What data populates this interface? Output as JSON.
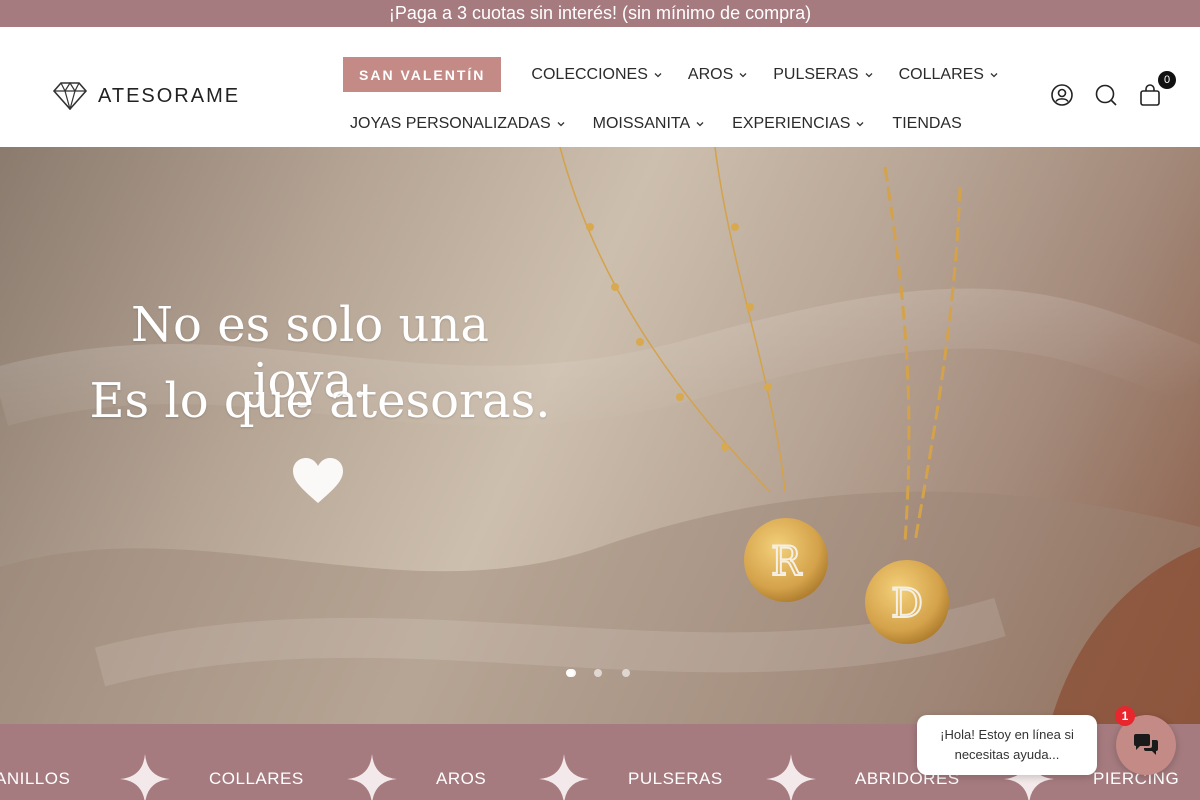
{
  "announcement": {
    "text": "¡Paga a 3 cuotas sin interés! (sin mínimo de compra)"
  },
  "header": {
    "logo_text": "ATESORAME",
    "nav_row1": [
      {
        "label": "SAN VALENTÍN",
        "highlight": true
      },
      {
        "label": "COLECCIONES",
        "dropdown": true
      },
      {
        "label": "AROS",
        "dropdown": true
      },
      {
        "label": "PULSERAS",
        "dropdown": true
      },
      {
        "label": "COLLARES",
        "dropdown": true
      }
    ],
    "nav_row2": [
      {
        "label": "JOYAS PERSONALIZADAS",
        "dropdown": true
      },
      {
        "label": "MOISSANITA",
        "dropdown": true
      },
      {
        "label": "EXPERIENCIAS",
        "dropdown": true
      },
      {
        "label": "TIENDAS",
        "dropdown": false
      }
    ],
    "icons": [
      "account-icon",
      "search-icon",
      "cart-icon"
    ],
    "cart_count": "0"
  },
  "hero": {
    "line1": "No es solo una joya.",
    "line2": "Es lo que atesoras.",
    "pendant_letters": [
      "R",
      "D"
    ],
    "slides": 3,
    "active_slide": 1
  },
  "categories": [
    {
      "label": "ANILLOS"
    },
    {
      "label": "COLLARES"
    },
    {
      "label": "AROS"
    },
    {
      "label": "PULSERAS"
    },
    {
      "label": "ABRIDORES"
    },
    {
      "label": "PIERCING"
    }
  ],
  "chat": {
    "message": "¡Hola! Estoy en línea si necesitas ayuda...",
    "badge": "1"
  },
  "colors": {
    "brand_mauve": "#a57b7f",
    "accent_rose": "#c48a85",
    "gold": "#d4a24a"
  }
}
